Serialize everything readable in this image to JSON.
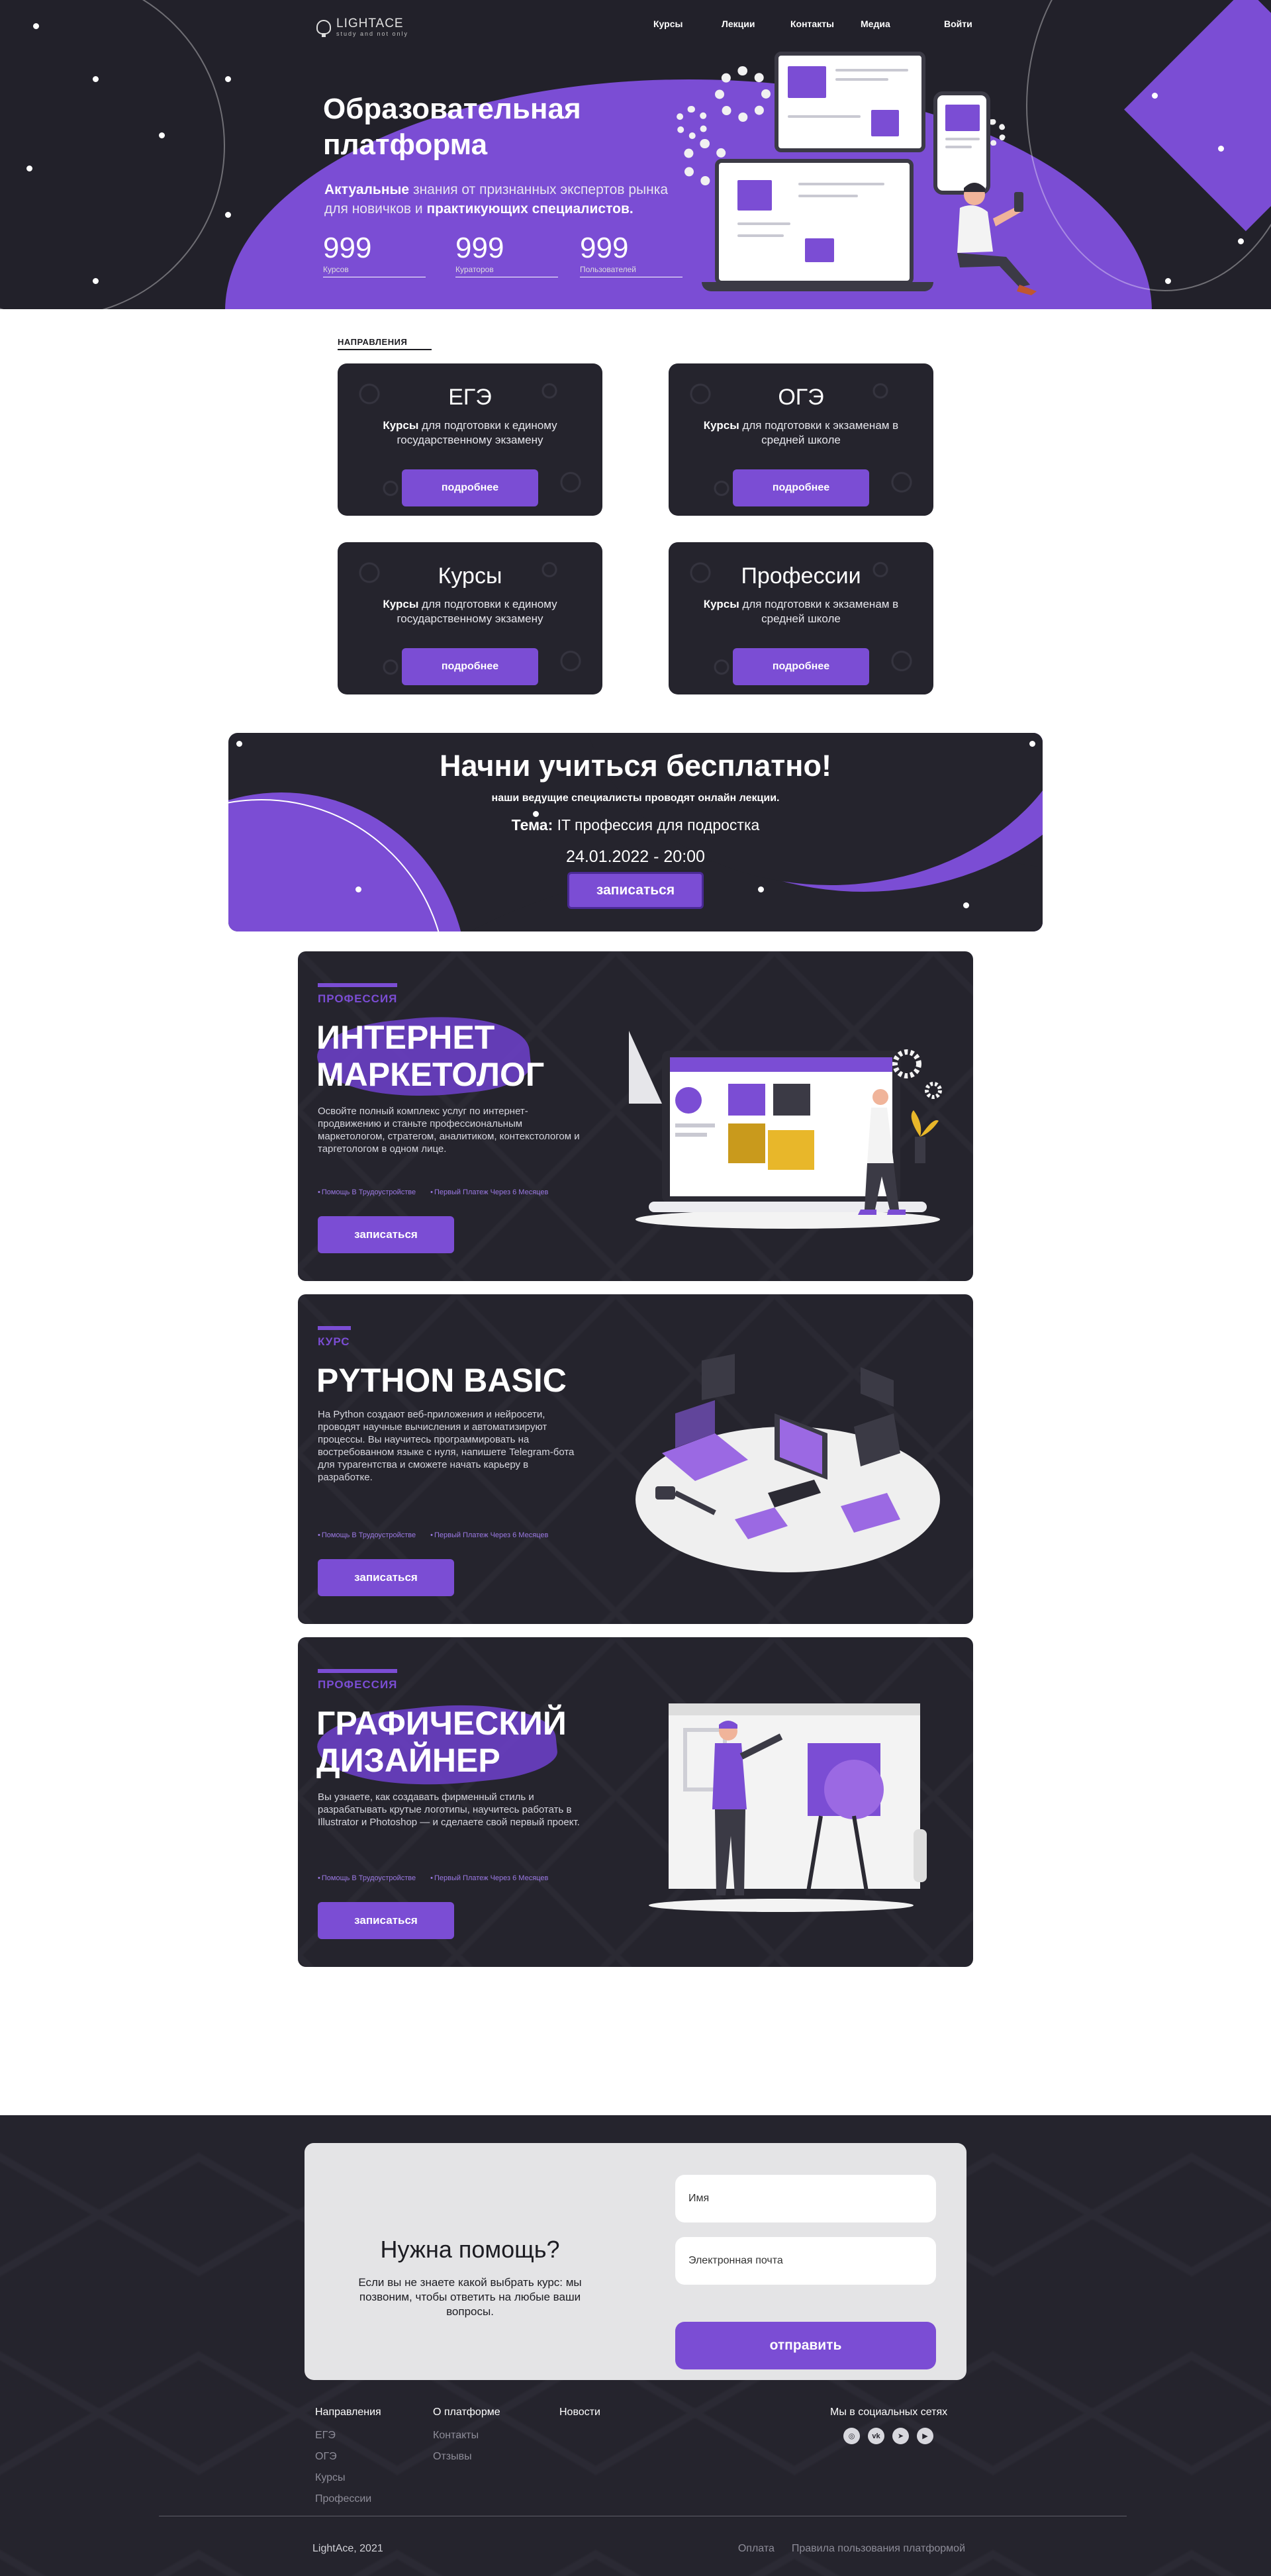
{
  "header": {
    "logo_text": "LIGHTACE",
    "logo_sub": "study and not only",
    "nav": [
      "Курсы",
      "Лекции",
      "Контакты",
      "Медиа"
    ],
    "login": "Войти"
  },
  "hero": {
    "title": "Образовательная платформа",
    "subtitle_pre": "Актуальные",
    "subtitle_mid1": " знания от признанных экспертов рынка для новичков и ",
    "subtitle_bold2": "практикующих специалистов.",
    "stats": [
      {
        "value": "999",
        "label": "Курсов"
      },
      {
        "value": "999",
        "label": "Кураторов"
      },
      {
        "value": "999",
        "label": "Пользователей"
      }
    ]
  },
  "directions": {
    "label": "НАПРАВЛЕНИЯ",
    "cards": [
      {
        "title": "ЕГЭ",
        "bold": "Курсы",
        "desc": " для подготовки к единому государственному экзамену",
        "button": "подробнее"
      },
      {
        "title": "ОГЭ",
        "bold": "Курсы",
        "desc": " для подготовки к экзаменам в средней школе",
        "button": "подробнее"
      },
      {
        "title": "Курсы",
        "bold": "Курсы",
        "desc": " для подготовки к единому государственному экзамену",
        "button": "подробнее"
      },
      {
        "title": "Профессии",
        "bold": "Курсы",
        "desc": " для подготовки к экзаменам в средней школе",
        "button": "подробнее"
      }
    ]
  },
  "banner": {
    "title": "Начни учиться бесплатно!",
    "subtitle": "наши ведущие специалисты проводят онлайн лекции.",
    "theme_label": "Тема:",
    "theme": " IT профессия для подростка",
    "date": "24.01.2022 - 20:00",
    "button": "записаться"
  },
  "courses": [
    {
      "tag": "ПРОФЕССИЯ",
      "title": "ИНТЕРНЕТ МАРКЕТОЛОГ",
      "desc": "Освойте полный комплекс услуг по интернет-продвижению и станьте профессиональным маркетологом, стратегом, аналитиком, контекстологом и таргетологом в одном лице.",
      "perks": [
        "Помощь В Трудоустройстве",
        "Первый Платеж Через 6 Месяцев"
      ],
      "button": "записаться"
    },
    {
      "tag": "КУРС",
      "title": "PYTHON BASIC",
      "desc": "На Python создают веб-приложения и нейросети, проводят научные вычисления и автоматизируют процессы. Вы научитесь программировать на востребованном языке с нуля, напишете Telegram-бота для турагентства и сможете начать карьеру в разработке.",
      "perks": [
        "Помощь В Трудоустройстве",
        "Первый Платеж Через 6 Месяцев"
      ],
      "button": "записаться"
    },
    {
      "tag": "ПРОФЕССИЯ",
      "title": "ГРАФИЧЕСКИЙ ДИЗАЙНЕР",
      "desc": "Вы узнаете, как создавать фирменный стиль и разрабатывать крутые логотипы, научитесь работать в Illustrator и Photoshop — и сделаете свой первый проект.",
      "perks": [
        "Помощь В Трудоустройстве",
        "Первый Платеж Через 6 Месяцев"
      ],
      "button": "записаться"
    }
  ],
  "help": {
    "title": "Нужна помощь?",
    "text": "Если вы не знаете какой выбрать курс: мы позвоним, чтобы ответить на любые ваши вопросы.",
    "name_placeholder": "Имя",
    "email_placeholder": "Электронная почта",
    "button": "отправить"
  },
  "footer": {
    "col1": {
      "title": "Направления",
      "items": [
        "ЕГЭ",
        "ОГЭ",
        "Курсы",
        "Профессии"
      ]
    },
    "col2": {
      "title": "О платформе",
      "items": [
        "Контакты",
        "Отзывы"
      ]
    },
    "col3": {
      "title": "Новости",
      "items": []
    },
    "social_title": "Мы в социальных сетях",
    "social_icons": [
      "instagram-icon",
      "vk-icon",
      "telegram-icon",
      "youtube-icon"
    ],
    "copyright": "LightAce, 2021",
    "links": [
      "Оплата",
      "Правила пользования платформой"
    ]
  },
  "colors": {
    "accent": "#7b4dd4",
    "dark": "#25242d",
    "hero_bg": "#22212a"
  }
}
